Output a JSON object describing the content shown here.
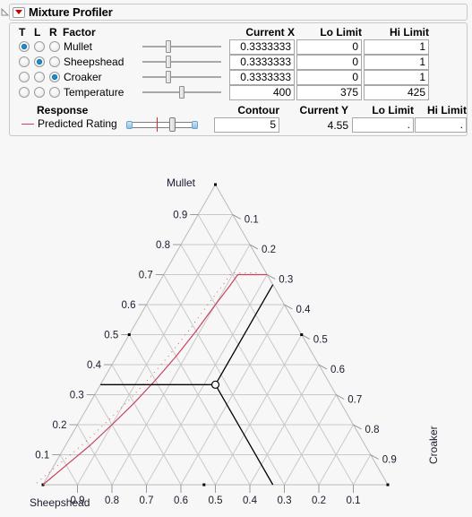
{
  "window": {
    "title": "Mixture Profiler",
    "menu_icon": "red-triangle-menu-icon",
    "disclosure_icon": "disclosure-triangle-icon"
  },
  "factor_table": {
    "axis_headers": [
      "T",
      "L",
      "R"
    ],
    "factor_header": "Factor",
    "value_headers": [
      "Current X",
      "Lo Limit",
      "Hi Limit"
    ],
    "rows": [
      {
        "name": "Mullet",
        "axis": "T",
        "t": true,
        "l": false,
        "r": false,
        "current_x": "0.3333333",
        "lo_limit": "0",
        "hi_limit": "1",
        "slider_pos": 0.333
      },
      {
        "name": "Sheepshead",
        "axis": "L",
        "t": false,
        "l": true,
        "r": false,
        "current_x": "0.3333333",
        "lo_limit": "0",
        "hi_limit": "1",
        "slider_pos": 0.333
      },
      {
        "name": "Croaker",
        "axis": "R",
        "t": false,
        "l": false,
        "r": true,
        "current_x": "0.3333333",
        "lo_limit": "0",
        "hi_limit": "1",
        "slider_pos": 0.333
      },
      {
        "name": "Temperature",
        "axis": "none",
        "t": false,
        "l": false,
        "r": false,
        "current_x": "400",
        "lo_limit": "375",
        "hi_limit": "425",
        "slider_pos": 0.5
      }
    ]
  },
  "response_table": {
    "response_header": "Response",
    "contour_header": "Contour",
    "current_y_header": "Current Y",
    "lo_limit_header": "Lo Limit",
    "hi_limit_header": "Hi Limit",
    "rows": [
      {
        "name": "Predicted Rating",
        "line_color": "#c8445c",
        "contour": "5",
        "current_y": "4.55",
        "lo_limit": ".",
        "hi_limit": ".",
        "slider_thumb_pos": 0.62,
        "slider_tick_pos": 0.42
      }
    ]
  },
  "chart_data": {
    "type": "ternary-contour",
    "title": "",
    "vertices": {
      "top": "Mullet",
      "bottom_left": "Sheepshead",
      "bottom_right": "Croaker"
    },
    "axes": [
      {
        "name": "Mullet",
        "position": "left",
        "label": "Mullet",
        "ticks": [
          0.1,
          0.2,
          0.3,
          0.4,
          0.5,
          0.6,
          0.7,
          0.8,
          0.9
        ],
        "tick_labels": [
          "0.1",
          "0.2",
          "0.3",
          "0.4",
          "0.5",
          "0.6",
          "0.7",
          "0.8",
          "0.9"
        ]
      },
      {
        "name": "Croaker",
        "position": "right",
        "label": "Croaker",
        "ticks": [
          0.1,
          0.2,
          0.3,
          0.4,
          0.5,
          0.6,
          0.7,
          0.8,
          0.9
        ],
        "tick_labels": [
          "0.1",
          "0.2",
          "0.3",
          "0.4",
          "0.5",
          "0.6",
          "0.7",
          "0.8",
          "0.9"
        ]
      },
      {
        "name": "Sheepshead",
        "position": "bottom",
        "label": "Sheepshead",
        "ticks": [
          0.9,
          0.8,
          0.7,
          0.6,
          0.5,
          0.4,
          0.3,
          0.2,
          0.1
        ],
        "tick_labels": [
          "0.9",
          "0.8",
          "0.7",
          "0.6",
          "0.5",
          "0.4",
          "0.3",
          "0.2",
          "0.1"
        ]
      }
    ],
    "grid": {
      "on": true,
      "step": 0.1,
      "color": "#c9c9c9"
    },
    "current_point": {
      "mullet": 0.3333333,
      "sheepshead": 0.3333333,
      "croaker": 0.3333333,
      "marker": "open-circle"
    },
    "contour_lines": [
      {
        "name": "Predicted Rating = 5",
        "color": "#c8445c",
        "style": "solid-with-dot-shadow",
        "points": [
          [
            0.0,
            1.0,
            0.0
          ],
          [
            0.065,
            0.9,
            0.035
          ],
          [
            0.13,
            0.8,
            0.07
          ],
          [
            0.2,
            0.7,
            0.1
          ],
          [
            0.272,
            0.6,
            0.128
          ],
          [
            0.348,
            0.5,
            0.152
          ],
          [
            0.428,
            0.4,
            0.172
          ],
          [
            0.512,
            0.3,
            0.188
          ],
          [
            0.6,
            0.2,
            0.2
          ],
          [
            0.66,
            0.13,
            0.21
          ],
          [
            0.7,
            0.085,
            0.215
          ],
          [
            0.7,
            0.0,
            0.3
          ]
        ]
      }
    ],
    "constraint_lines": [
      {
        "name": "mullet-constraint",
        "color": "#000000",
        "points": [
          [
            0.3333333,
            0.6666667,
            0.0
          ],
          [
            0.3333333,
            0.3333333,
            0.3333333
          ]
        ]
      },
      {
        "name": "croaker-constraint",
        "color": "#000000",
        "points": [
          [
            0.3333333,
            0.3333333,
            0.3333333
          ],
          [
            0.6666667,
            0.0,
            0.3333333
          ]
        ]
      },
      {
        "name": "sheepshead-constraint",
        "color": "#000000",
        "points": [
          [
            0.3333333,
            0.3333333,
            0.3333333
          ],
          [
            0.0,
            0.3333333,
            0.6666667
          ]
        ]
      }
    ],
    "edge_ticks": [
      {
        "axis": "left",
        "value": 0.5
      },
      {
        "axis": "right",
        "value": 0.5
      },
      {
        "axis": "bottom",
        "value": 0.533
      }
    ]
  }
}
